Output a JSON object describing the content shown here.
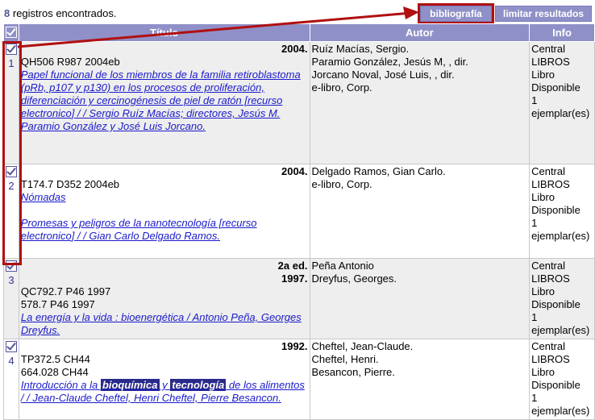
{
  "results": {
    "count": "8",
    "count_text": "registros encontrados."
  },
  "buttons": {
    "bibliography": "bibliografía",
    "limit": "limitar resultados"
  },
  "columns": {
    "title": "Título",
    "author": "Autor",
    "info": "Info"
  },
  "records": [
    {
      "num": "1",
      "edition": "",
      "year": "2004.",
      "call_numbers": [
        "QH506 R987 2004eb"
      ],
      "title_link": "Papel funcional de los miembros de la familia retiroblastoma (pRb, p107 y p130) en los procesos de proliferación, diferenciación y cercinogénesis de piel de ratón [recurso electronico] / / Sergio Ruíz Macías; directores, Jesús M. Paramio González y José Luis Jorcano.",
      "series_link": "",
      "authors": [
        "Ruíz Macías, Sergio.",
        "Paramio González, Jesús M, , dir.",
        "Jorcano Noval, José Luis, , dir.",
        "e-libro, Corp."
      ],
      "info": [
        "Central",
        "LIBROS",
        "Libro",
        "Disponible",
        "1",
        "ejemplar(es)"
      ]
    },
    {
      "num": "2",
      "edition": "",
      "year": "2004.",
      "call_numbers": [
        "T174.7 D352 2004eb"
      ],
      "series_link": "Nómadas",
      "title_link": "Promesas y peligros de la nanotecnología [recurso electronico] / / Gian Carlo Delgado Ramos.",
      "authors": [
        "Delgado Ramos, Gian Carlo.",
        "e-libro, Corp."
      ],
      "info": [
        "Central",
        "LIBROS",
        "Libro",
        "Disponible",
        "1",
        "ejemplar(es)"
      ]
    },
    {
      "num": "3",
      "edition": "2a ed.",
      "year": "1997.",
      "call_numbers": [
        "QC792.7 P46 1997",
        "578.7 P46 1997"
      ],
      "series_link": "",
      "title_link": "La energía y la vida : bioenergética / Antonio Peña, Georges Dreyfus.",
      "authors": [
        "Peña Antonio",
        "Dreyfus, Georges."
      ],
      "info": [
        "Central",
        "LIBROS",
        "Libro",
        "Disponible",
        "1",
        "ejemplar(es)"
      ]
    },
    {
      "num": "4",
      "edition": "",
      "year": "1992.",
      "call_numbers": [
        "TP372.5 CH44",
        "664.028 CH44"
      ],
      "series_link": "",
      "title_link_parts": [
        "Introducción a la ",
        "bioquímica",
        " y ",
        "tecnología",
        " de los alimentos / / Jean-Claude Cheftel, Henri Cheftel, Pierre Besancon."
      ],
      "authors": [
        "Cheftel, Jean-Claude.",
        "Cheftel, Henri.",
        "Besancon, Pierre."
      ],
      "info": [
        "Central",
        "LIBROS",
        "Libro",
        "Disponible",
        "1",
        "ejemplar(es)"
      ]
    }
  ],
  "colors": {
    "header_bg": "#9090c8",
    "highlight_red": "#b01010",
    "link": "#1a1acc"
  }
}
